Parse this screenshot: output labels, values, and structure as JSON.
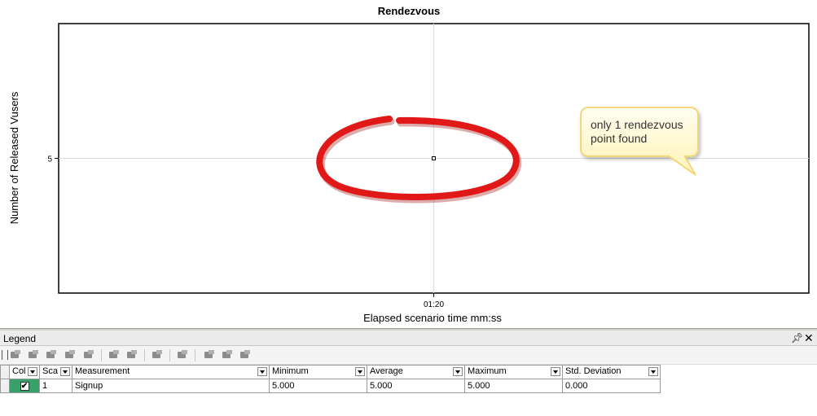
{
  "chart_data": {
    "type": "scatter",
    "title": "Rendezvous",
    "xlabel": "Elapsed scenario time mm:ss",
    "ylabel": "Number of Released Vusers",
    "x_ticks": [
      "01:20"
    ],
    "y_ticks": [
      5
    ],
    "xlim": [
      70,
      90
    ],
    "ylim": [
      0,
      10
    ],
    "grid": true,
    "series": [
      {
        "name": "Signup",
        "x": [
          80
        ],
        "y": [
          5
        ],
        "x_display": [
          "01:20"
        ]
      }
    ],
    "annotations": [
      "only 1 rendezvous point found"
    ],
    "highlight_color": "#e01818"
  },
  "callout": {
    "line1": "only 1 rendezvous",
    "line2": "point found"
  },
  "legend": {
    "title": "Legend",
    "pin_icon": "pin-icon",
    "close_icon": "close-icon",
    "columns": [
      {
        "key": "color",
        "label": "Col"
      },
      {
        "key": "scale",
        "label": "Sca"
      },
      {
        "key": "measurement",
        "label": "Measurement"
      },
      {
        "key": "minimum",
        "label": "Minimum"
      },
      {
        "key": "average",
        "label": "Average"
      },
      {
        "key": "maximum",
        "label": "Maximum"
      },
      {
        "key": "std_deviation",
        "label": "Std. Deviation"
      }
    ],
    "rows": [
      {
        "checked": true,
        "color": "#3aa06a",
        "scale": "1",
        "measurement": "Signup",
        "minimum": "5.000",
        "average": "5.000",
        "maximum": "5.000",
        "std_deviation": "0.000"
      }
    ]
  },
  "toolbar_icons": [
    "add-measurement-icon",
    "delete-measurement-icon",
    "configure-icon",
    "link-icon",
    "filter-icon",
    "show-only-selected-icon",
    "hide-selected-icon",
    "show-all-icon",
    "auto-correlate-icon",
    "copy-icon",
    "paste-icon",
    "export-icon"
  ]
}
